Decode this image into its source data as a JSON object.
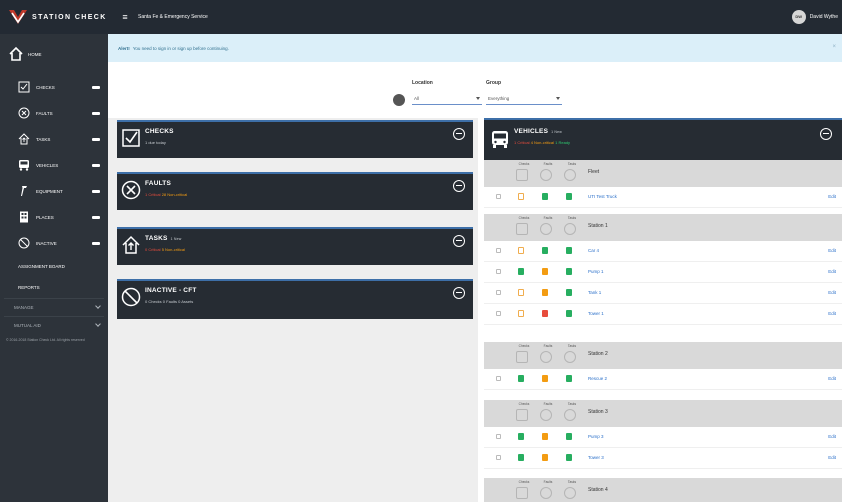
{
  "header": {
    "brand": "STATION CHECK",
    "menu_glyph": "≡",
    "org": "Santa Fe & Emergency Service",
    "user_initials": "DW",
    "user_name": "David Wythe"
  },
  "sidebar": {
    "home": "HOME",
    "items": [
      {
        "label": "CHECKS",
        "icon": "checkbox-icon"
      },
      {
        "label": "FAULTS",
        "icon": "circle-x-icon"
      },
      {
        "label": "TASKS",
        "icon": "house-up-icon"
      },
      {
        "label": "VEHICLES",
        "icon": "bus-icon"
      },
      {
        "label": "EQUIPMENT",
        "icon": "tool-icon"
      },
      {
        "label": "PLACES",
        "icon": "building-icon"
      },
      {
        "label": "INACTIVE",
        "icon": "no-entry-icon"
      }
    ],
    "links": [
      "ASSIGNMENT BOARD",
      "REPORTS"
    ],
    "dropdowns": [
      "MANAGE",
      "MUTUAL AID"
    ],
    "copyright": "© 2016-2018 Station Check Ltd. All rights reserved"
  },
  "alert": {
    "label": "Alert!",
    "text": "You need to sign in or sign up before continuing.",
    "close": "×"
  },
  "filters": {
    "location_label": "Location",
    "location_value": "All",
    "group_label": "Group",
    "group_value": "Everything"
  },
  "cards": {
    "checks": {
      "title": "CHECKS",
      "sub": "1 due today"
    },
    "faults": {
      "title": "FAULTS",
      "sub_red": "1 Critical",
      "sub_orange": "28 Non-critical"
    },
    "tasks": {
      "title": "TASKS",
      "badge": "1 New",
      "sub_red": "0 Critical",
      "sub_orange": "5 Non-critical"
    },
    "inactive": {
      "title": "INACTIVE - CFT",
      "sub": "0 Checks  0 Faults  0 Assets"
    }
  },
  "vehicles": {
    "title": "VEHICLES",
    "badge": "1 New",
    "sub_red": "1 Critical",
    "sub_orange": "4 Non-critical",
    "sub_green": "1 Ready",
    "col_heads": [
      "Checks",
      "Faults",
      "Tasks"
    ],
    "edit_label": "Edit",
    "groups": [
      {
        "name": "Fleet",
        "rows": [
          {
            "name": "UTI Test Truck",
            "checks": "outline",
            "faults": "green",
            "tasks": "green"
          }
        ]
      },
      {
        "name": "Station 1",
        "rows": [
          {
            "name": "Car 4",
            "checks": "outline",
            "faults": "green",
            "tasks": "green"
          },
          {
            "name": "Pump 1",
            "checks": "green",
            "faults": "orange",
            "tasks": "green"
          },
          {
            "name": "Tank 1",
            "checks": "outline",
            "faults": "orange",
            "tasks": "green"
          },
          {
            "name": "Tower 1",
            "checks": "outline",
            "faults": "red",
            "tasks": "green"
          }
        ]
      },
      {
        "name": "Station 2",
        "rows": [
          {
            "name": "Rescue 2",
            "checks": "green",
            "faults": "orange",
            "tasks": "green"
          }
        ]
      },
      {
        "name": "Station 3",
        "rows": [
          {
            "name": "Pump 3",
            "checks": "green",
            "faults": "orange",
            "tasks": "green"
          },
          {
            "name": "Tower 3",
            "checks": "green",
            "faults": "orange",
            "tasks": "green"
          }
        ]
      },
      {
        "name": "Station 4",
        "rows": []
      }
    ]
  },
  "colors": {
    "topbar": "#232a33",
    "sidebar": "#2d333a",
    "card": "#262c33",
    "accent": "#3d6fa8",
    "alert_bg": "#dbeff9",
    "link": "#2a6fc9",
    "critical": "#e74c3c",
    "noncritical": "#f39c12",
    "ok": "#27ae60"
  }
}
